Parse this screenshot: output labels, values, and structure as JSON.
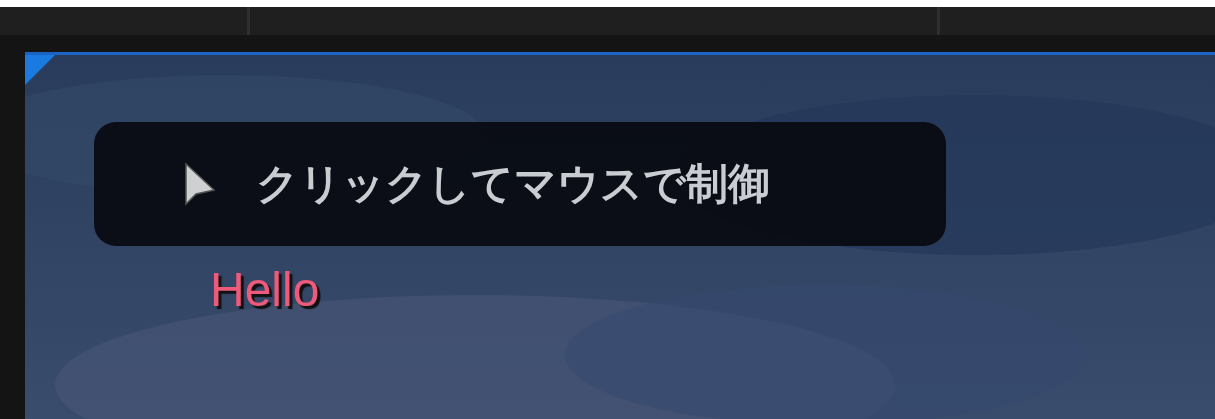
{
  "prompt": {
    "text": "クリックしてマウスで制御"
  },
  "debug_message": "Hello"
}
